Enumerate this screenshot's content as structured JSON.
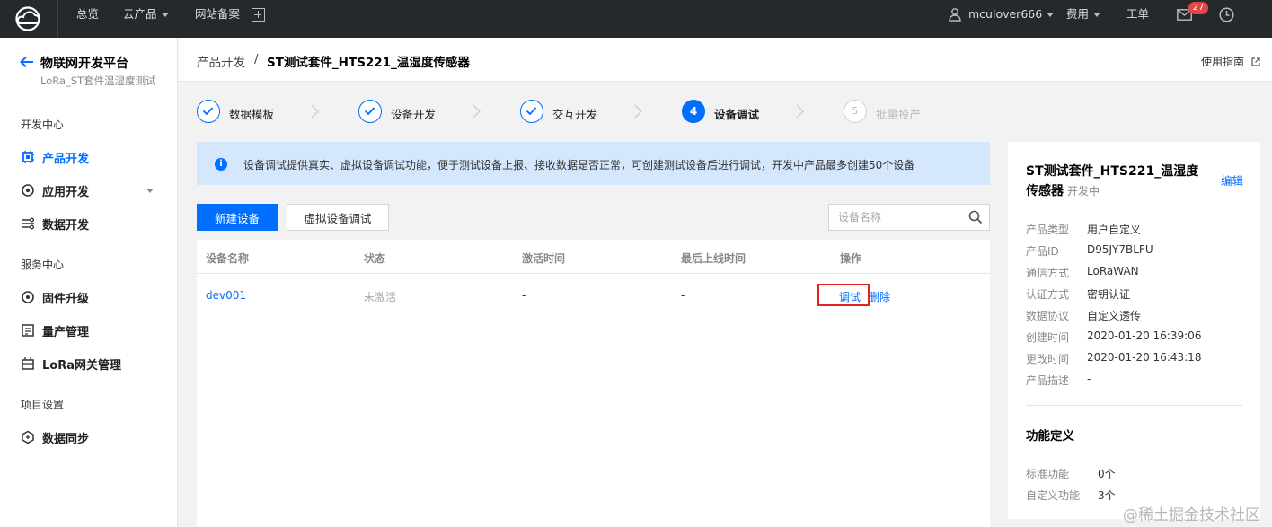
{
  "topbar": {
    "nav": [
      "总览",
      "云产品",
      "网站备案"
    ],
    "user": "mculover666",
    "fees": "费用",
    "ticket": "工单",
    "mail_count": "27"
  },
  "sidebar": {
    "title": "物联网开发平台",
    "subtitle": "LoRa_ST套件温湿度测试",
    "sections": [
      "开发中心",
      "服务中心",
      "项目设置"
    ],
    "items": [
      {
        "label": "产品开发",
        "icon": "chip-icon",
        "active": true
      },
      {
        "label": "应用开发",
        "icon": "gear-icon"
      },
      {
        "label": "数据开发",
        "icon": "flow-icon"
      },
      {
        "label": "固件升级",
        "icon": "refresh-icon"
      },
      {
        "label": "量产管理",
        "icon": "list-icon"
      },
      {
        "label": "LoRa网关管理",
        "icon": "gateway-icon"
      },
      {
        "label": "数据同步",
        "icon": "sync-icon"
      }
    ]
  },
  "header": {
    "crumb1": "产品开发",
    "crumb_sep": "/",
    "crumb2": "ST测试套件_HTS221_温湿度传感器",
    "guide": "使用指南"
  },
  "steps": [
    {
      "label": "数据模板",
      "state": "done"
    },
    {
      "label": "设备开发",
      "state": "done"
    },
    {
      "label": "交互开发",
      "state": "done"
    },
    {
      "num": "4",
      "label": "设备调试",
      "state": "current"
    },
    {
      "num": "5",
      "label": "批量投产",
      "state": "disabled"
    }
  ],
  "info": {
    "icon": "i",
    "text": "设备调试提供真实、虚拟设备调试功能，便于测试设备上报、接收数据是否正常，可创建测试设备后进行调试，开发中产品最多创建50个设备"
  },
  "toolbar": {
    "new_device": "新建设备",
    "virtual_debug": "虚拟设备调试",
    "search_placeholder": "设备名称"
  },
  "table": {
    "headers": [
      "设备名称",
      "状态",
      "激活时间",
      "最后上线时间",
      "操作"
    ],
    "rows": [
      {
        "name": "dev001",
        "status": "未激活",
        "activated": "-",
        "last_online": "-",
        "debug": "调试",
        "delete": "删除"
      }
    ]
  },
  "panel": {
    "title": "ST测试套件_HTS221_温湿度传感器",
    "status": "开发中",
    "edit": "编辑",
    "props": [
      {
        "k": "产品类型",
        "v": "用户自定义"
      },
      {
        "k": "产品ID",
        "v": "D95JY7BLFU"
      },
      {
        "k": "通信方式",
        "v": "LoRaWAN"
      },
      {
        "k": "认证方式",
        "v": "密钥认证"
      },
      {
        "k": "数据协议",
        "v": "自定义透传"
      },
      {
        "k": "创建时间",
        "v": "2020-01-20 16:39:06"
      },
      {
        "k": "更改时间",
        "v": "2020-01-20 16:43:18"
      },
      {
        "k": "产品描述",
        "v": "-"
      }
    ],
    "func_title": "功能定义",
    "funcs": [
      {
        "k": "标准功能",
        "v": "0个"
      },
      {
        "k": "自定义功能",
        "v": "3个"
      }
    ]
  },
  "watermark": "@稀土掘金技术社区",
  "colors": {
    "accent": "#006eff",
    "topbar": "#26292c",
    "highlight": "#e02424"
  }
}
